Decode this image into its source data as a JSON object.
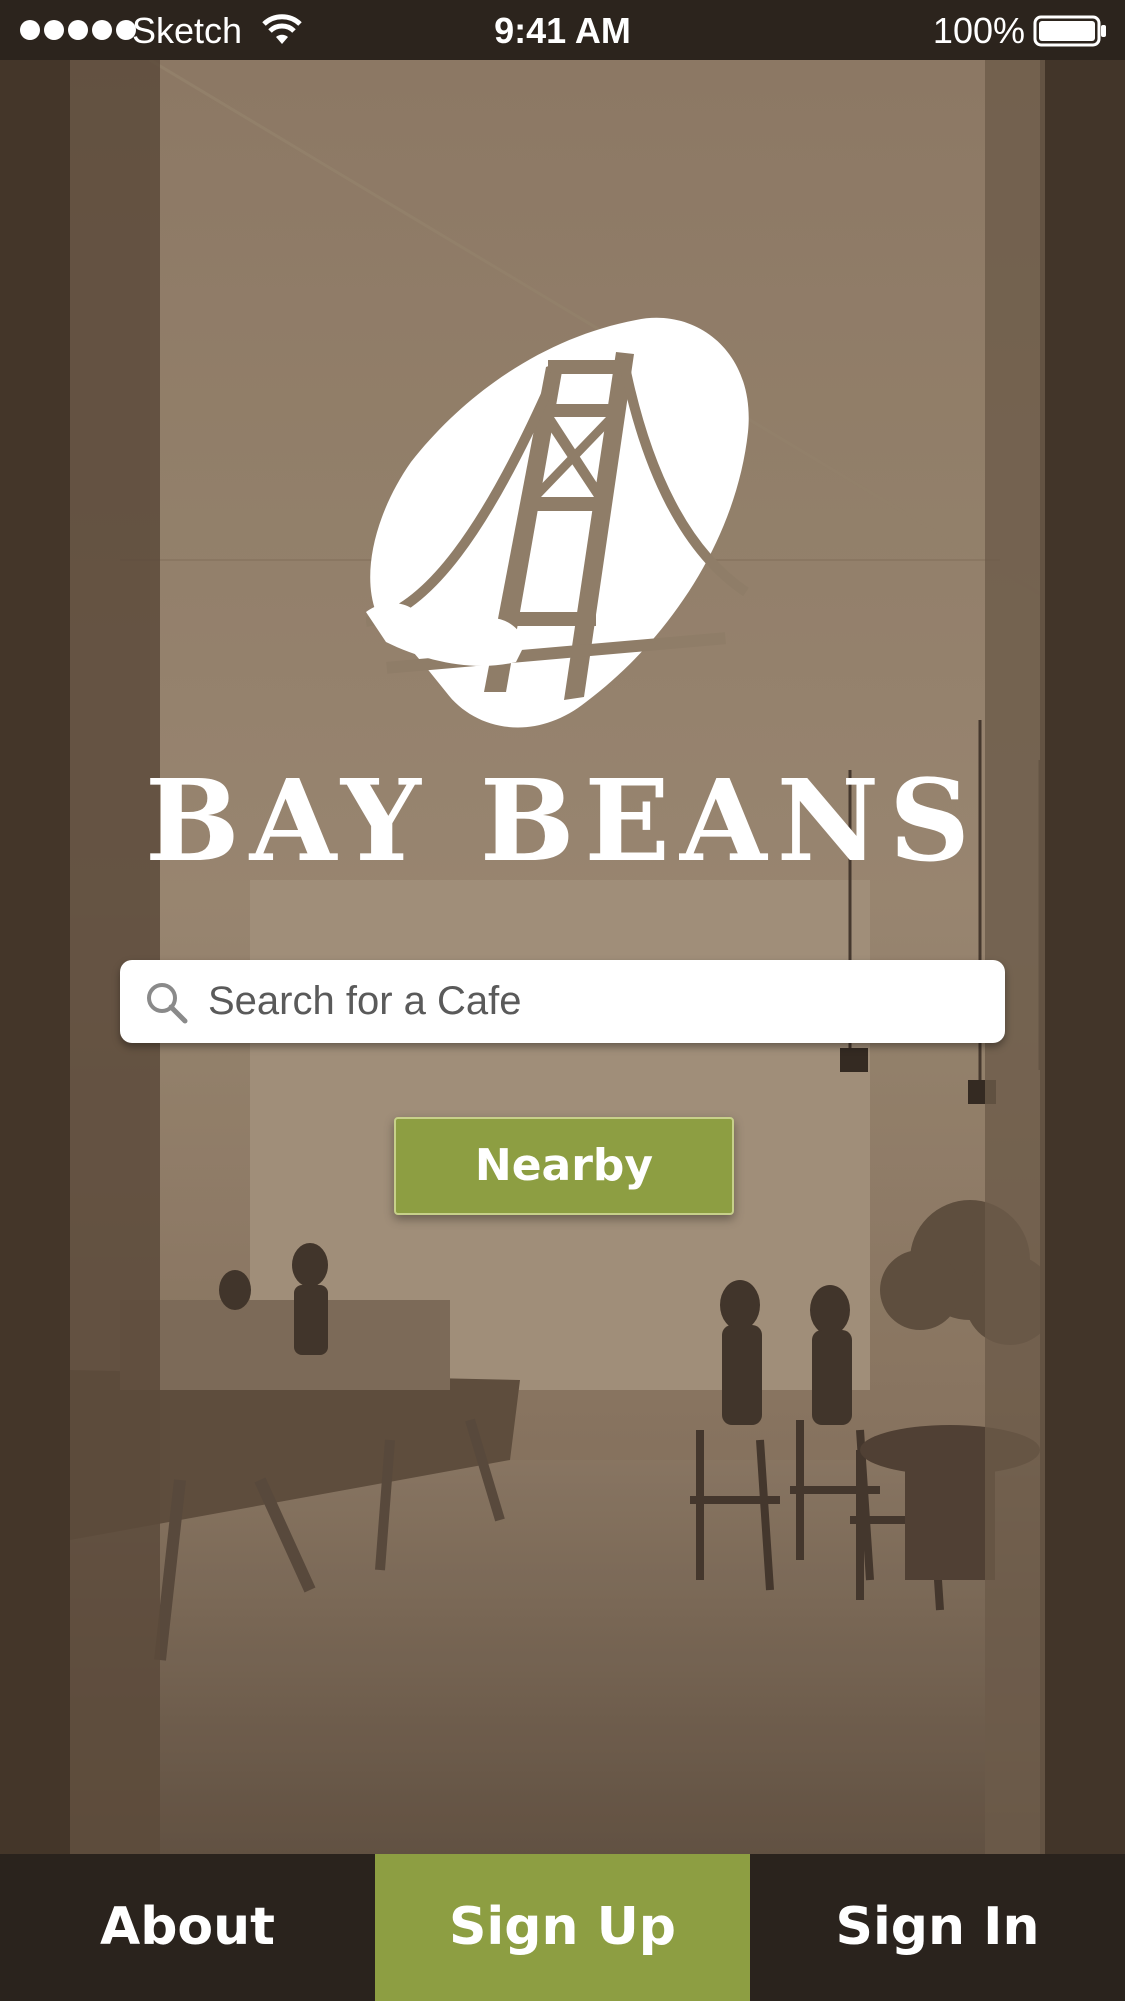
{
  "status_bar": {
    "carrier": "Sketch",
    "time": "9:41 AM",
    "battery_percent": "100%",
    "signal_icon": "signal-dots-icon",
    "wifi_icon": "wifi-icon",
    "battery_icon": "battery-icon"
  },
  "brand": {
    "title": "BAY BEANS",
    "logo_icon": "golden-gate-bridge-bean-logo"
  },
  "search": {
    "placeholder": "Search for a Cafe",
    "value": "",
    "icon": "search-icon"
  },
  "nearby_button": {
    "label": "Nearby"
  },
  "bottom_nav": {
    "about": "About",
    "sign_up": "Sign Up",
    "sign_in": "Sign In"
  },
  "colors": {
    "accent_green": "#8d9e42",
    "dark_brown": "#2a231d",
    "sepia_overlay": "#8a7660"
  }
}
